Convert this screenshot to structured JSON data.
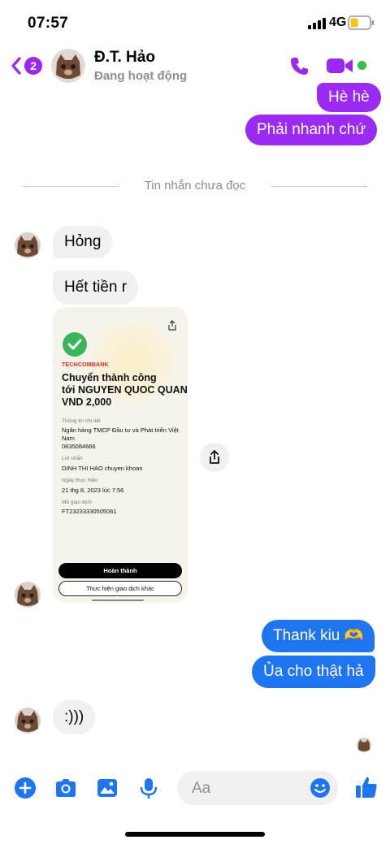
{
  "status_bar": {
    "time": "07:57",
    "network": "4G"
  },
  "header": {
    "back_badge": "2",
    "contact_name": "Đ.T. Hảo",
    "contact_status": "Đang hoạt động"
  },
  "colors": {
    "accent": "#9c27f0",
    "outgoing_purple": "#9b2bf2",
    "outgoing_blue": "#1f74f0",
    "online": "#31c24d"
  },
  "messages": {
    "out_1": "Hè hè",
    "out_2": "Phải nhanh chứ",
    "divider": "Tin nhắn chưa đọc",
    "in_1": "Hỏng",
    "in_2": "Hết tiền r",
    "out_3": "Thank kiu 🫶",
    "out_4": "Ủa cho thật hả",
    "in_3": ":)))"
  },
  "receipt": {
    "bank": "TECHCOMBANK",
    "title_1": "Chuyển thành công",
    "title_2": "tới NGUYEN QUOC QUAN",
    "amount": "VND 2,000",
    "detail_label": "Thông tin chi tiết",
    "bank_name_1": "Ngân hàng TMCP Đầu tư và Phát triển Việt",
    "bank_name_2": "Nam",
    "account": "0835084666",
    "note_label": "Lời nhắn",
    "note": "DINH THI HAO chuyen khoan",
    "date_label": "Ngày thực hiện",
    "date": "21 thg 8, 2023 lúc 7:56",
    "txn_label": "Mã giao dịch",
    "txn": "FT23233330505061",
    "btn_done": "Hoàn thành",
    "btn_other": "Thực hiện giao dịch khác"
  },
  "composer": {
    "placeholder": "Aa"
  },
  "icons": [
    "plus-circle-icon",
    "camera-icon",
    "gallery-icon",
    "microphone-icon",
    "emoji-icon",
    "thumbs-up-icon",
    "phone-icon",
    "video-icon",
    "share-icon"
  ]
}
